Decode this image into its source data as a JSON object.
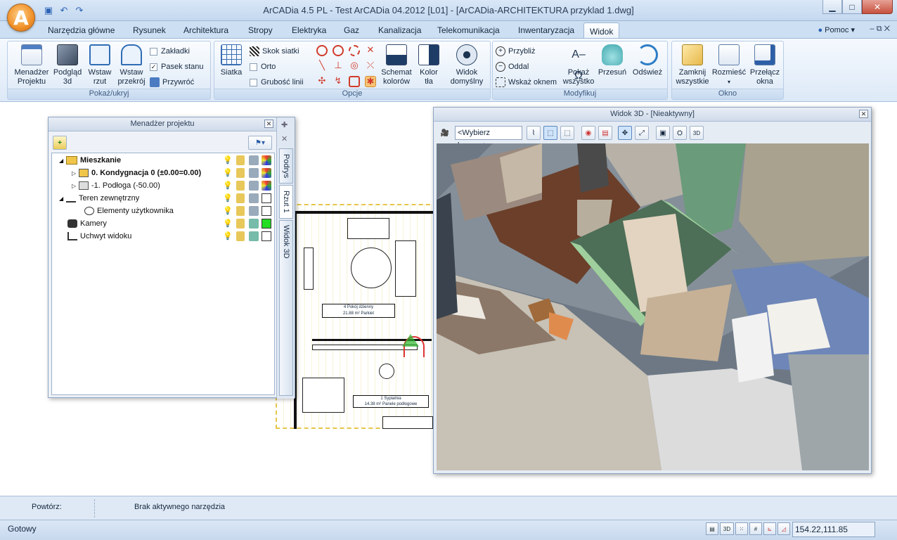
{
  "window": {
    "title": "ArCADia 4.5 PL - Test ArCADia 04.2012 [L01] - [ArCADia-ARCHITEKTURA przyklad 1.dwg]",
    "logo_letter": "A"
  },
  "ribbon_tabs": [
    "Narzędzia główne",
    "Rysunek",
    "Architektura",
    "Stropy",
    "Elektryka",
    "Gaz",
    "Kanalizacja",
    "Telekomunikacja",
    "Inwentaryzacja",
    "Widok"
  ],
  "active_tab": "Widok",
  "help_label": "Pomoc",
  "groups": {
    "pokaz": {
      "title": "Pokaż/ukryj",
      "menadzer": "Menadżer\nProjektu",
      "podglad": "Podgląd\n3d",
      "wstaw_rzut": "Wstaw\nrzut",
      "wstaw_przekroj": "Wstaw\nprzekrój",
      "zakladki": "Zakładki",
      "pasek": "Pasek stanu",
      "przywroc": "Przywróć"
    },
    "opcje": {
      "title": "Opcje",
      "siatka": "Siatka",
      "skok": "Skok siatki",
      "orto": "Orto",
      "grubosc": "Grubość linii",
      "schemat": "Schemat\nkolorów",
      "kolor_tla": "Kolor\ntła",
      "widok_dom": "Widok\ndomyślny"
    },
    "modyfikuj": {
      "title": "Modyfikuj",
      "przybliz": "Przybliż",
      "oddal": "Oddal",
      "wskaz": "Wskaż oknem",
      "pokaz_wszystko": "Pokaż\nwszystko",
      "przesun": "Przesuń",
      "odswiez": "Odśwież"
    },
    "okno": {
      "title": "Okno",
      "zamknij": "Zamknij\nwszystkie",
      "rozmiesc": "Rozmieść",
      "przelacz": "Przełącz\nokna"
    }
  },
  "project_manager": {
    "title": "Menadżer projektu",
    "side_tabs": [
      "Podrys",
      "Rzut 1",
      "Widok 3D"
    ],
    "items": [
      {
        "label": "Mieszkanie",
        "bold": true
      },
      {
        "label": "0. Kondygnacja 0 (±0.00=0.00)",
        "bold": true
      },
      {
        "label": "-1. Podłoga (-50.00)",
        "bold": false
      },
      {
        "label": "Teren zewnętrzny",
        "bold": false
      },
      {
        "label": "Elementy użytkownika",
        "bold": false
      },
      {
        "label": "Kamery",
        "bold": false
      },
      {
        "label": "Uchwyt widoku",
        "bold": false
      }
    ]
  },
  "view3d": {
    "title": "Widok 3D - [Nieaktywny]",
    "camera_placeholder": "<Wybierz kamerę>"
  },
  "bottom": {
    "repeat_label": "Powtórz:",
    "tool_status": "Brak aktywnego narzędzia"
  },
  "status": {
    "state": "Gotowy",
    "coords": "154.22,111.85",
    "icon_3d": "3D"
  },
  "plan_labels": {
    "room1": "Pokój dzienny",
    "room1_floor": "Parkiet",
    "room1_num": "4",
    "room1_area": "21.88 m²",
    "room2": "Sypialnia",
    "room2_floor": "Panele podłogowe",
    "room2_num": "1",
    "room2_area": "14.38 m²"
  },
  "colors": {
    "accent_orange": "#f09028",
    "ribbon_blue": "#cddff2",
    "green_swatch": "#22dd22"
  }
}
